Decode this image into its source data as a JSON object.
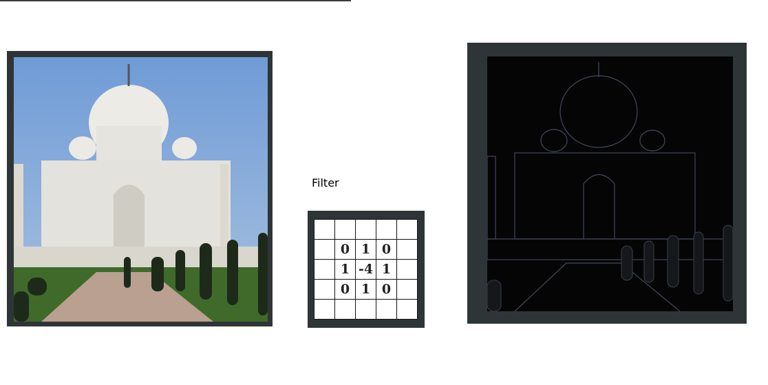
{
  "filter": {
    "label": "Filter",
    "grid": [
      [
        "",
        "",
        "",
        "",
        ""
      ],
      [
        "",
        "0",
        "1",
        "0",
        ""
      ],
      [
        "",
        "1",
        "-4",
        "1",
        ""
      ],
      [
        "",
        "0",
        "1",
        "0",
        ""
      ],
      [
        "",
        "",
        "",
        "",
        ""
      ]
    ]
  },
  "colors": {
    "frame": "#2f3537",
    "sky": "#7ea6d8",
    "edge_bg": "#050506"
  }
}
